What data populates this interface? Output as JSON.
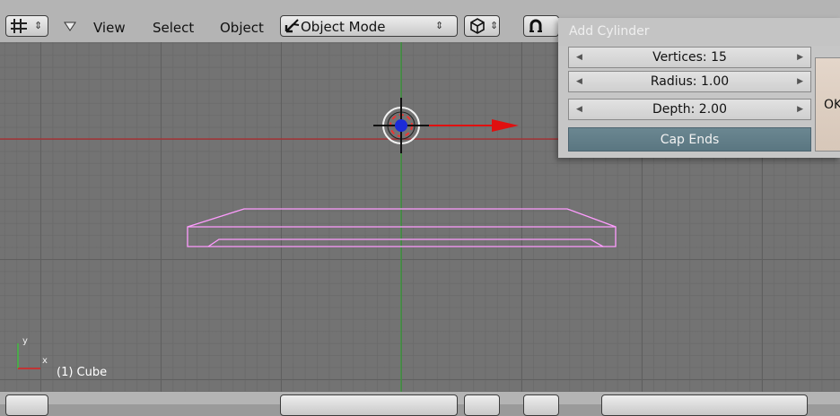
{
  "header": {
    "menu": [
      "View",
      "Select",
      "Object"
    ],
    "mode": "Object Mode"
  },
  "viewport": {
    "object_label": "(1) Cube",
    "axis_x": "x",
    "axis_y": "y"
  },
  "dialog": {
    "title": "Add Cylinder",
    "vertices": "Vertices: 15",
    "radius": "Radius: 1.00",
    "depth": "Depth: 2.00",
    "cap_ends": "Cap Ends",
    "ok": "OK"
  },
  "colors": {
    "grid_bg": "#737373",
    "header_bg": "#b4b4b4",
    "selection_outline": "#ff9cff",
    "x_axis": "#c0262a",
    "y_axis": "#37a337",
    "toggle_active": "#5e7a85"
  },
  "icons": {
    "editor_type": "grid-icon",
    "mode": "object-mode-icon",
    "draw_type": "cube-icon",
    "pivot": "magnet-icon"
  }
}
